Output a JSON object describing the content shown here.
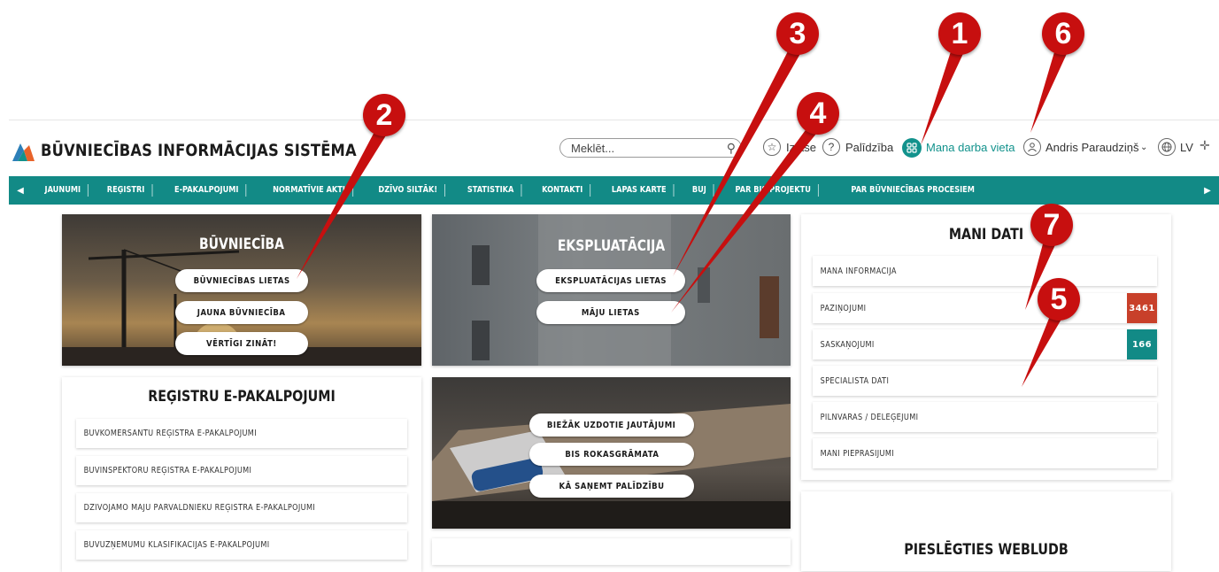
{
  "header": {
    "brand": "BŪVNIECĪBAS INFORMĀCIJAS SISTĒMA",
    "search_placeholder": "Meklēt...",
    "favorites_label": "Izlase",
    "help_label": "Palīdzība",
    "workspace_label": "Mana darba vieta",
    "user_name": "Andris Paraudziņš",
    "language": "LV"
  },
  "nav": {
    "items": [
      "JAUNUMI",
      "REĢISTRI",
      "E-PAKALPOJUMI",
      "NORMATĪVIE AKTI",
      "DZĪVO SILTĀK!",
      "STATISTIKA",
      "KONTAKTI",
      "LAPAS KARTE",
      "BUJ",
      "PAR BIS PROJEKTU",
      "PAR BŪVNIECĪBAS PROCESIEM"
    ]
  },
  "buvnieciba": {
    "title": "BŪVNIECĪBA",
    "buttons": [
      "BŪVNIECĪBAS LIETAS",
      "JAUNA BŪVNIECĪBA",
      "VĒRTĪGI ZINĀT!"
    ]
  },
  "ekspluatacija": {
    "title": "EKSPLUATĀCIJA",
    "buttons": [
      "EKSPLUATĀCIJAS LIETAS",
      "MĀJU LIETAS"
    ]
  },
  "help_tile": {
    "buttons": [
      "BIEŽĀK UZDOTIE JAUTĀJUMI",
      "BIS ROKASGRĀMATA",
      "KĀ SAŅEMT PALĪDZĪBU"
    ]
  },
  "registri": {
    "title": "REĢISTRU E-PAKALPOJUMI",
    "items": [
      "BŪVKOMERSANTU REĢISTRA E-PAKALPOJUMI",
      "BŪVINSPEKTORU REĢISTRA E-PAKALPOJUMI",
      "DZĪVOJAMO MĀJU PĀRVALDNIEKU REĢISTRA E-PAKALPOJUMI",
      "BŪVUZŅĒMUMU KLASIFIKĀCIJAS E-PAKALPOJUMI"
    ]
  },
  "mani_dati": {
    "title": "MANI DATI",
    "items": [
      {
        "label": "MANA INFORMĀCIJA",
        "badge": null
      },
      {
        "label": "PAZIŅOJUMI",
        "badge": "3461",
        "badge_color": "#c8402a"
      },
      {
        "label": "SASKAŅOJUMI",
        "badge": "166",
        "badge_color": "#128a86"
      },
      {
        "label": "SPECIĀLISTA DATI",
        "badge": null
      },
      {
        "label": "PILNVARAS / DELEĢĒJUMI",
        "badge": null
      },
      {
        "label": "MANI PIEPRASĪJUMI",
        "badge": null
      }
    ]
  },
  "weblapa": {
    "title": "PIESLĒGTIES WEBLUDB"
  },
  "annotations": [
    "1",
    "2",
    "3",
    "4",
    "5",
    "6",
    "7"
  ],
  "colors": {
    "accent": "#128a86",
    "marker": "#c70f0f",
    "notifications_badge": "#c8402a"
  }
}
